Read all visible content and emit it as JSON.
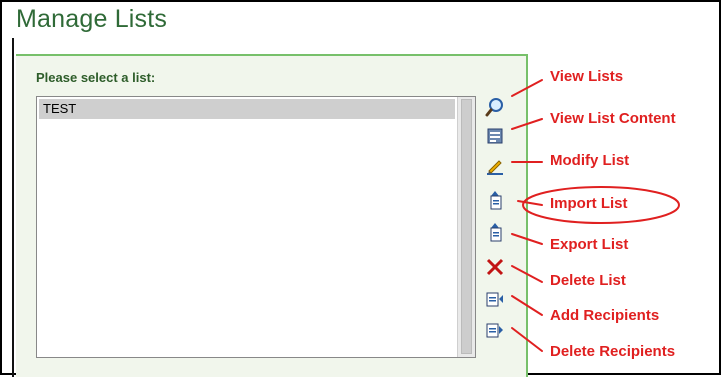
{
  "page": {
    "title": "Manage Lists"
  },
  "panel": {
    "label": "Please select a list:",
    "list_items": [
      "TEST"
    ]
  },
  "toolbar": {
    "items": [
      {
        "label": "View Lists",
        "icon": "magnifier-icon"
      },
      {
        "label": "View List Content",
        "icon": "list-content-icon"
      },
      {
        "label": "Modify List",
        "icon": "modify-pencil-icon"
      },
      {
        "label": "Import List",
        "icon": "import-document-icon"
      },
      {
        "label": "Export List",
        "icon": "export-document-icon"
      },
      {
        "label": "Delete List",
        "icon": "red-x-icon"
      },
      {
        "label": "Add Recipients",
        "icon": "add-recipients-icon"
      },
      {
        "label": "Delete Recipients",
        "icon": "delete-recipients-icon"
      }
    ]
  },
  "colors": {
    "title_green": "#2f6a37",
    "panel_border": "#77c06a",
    "callout_red": "#e02020"
  }
}
